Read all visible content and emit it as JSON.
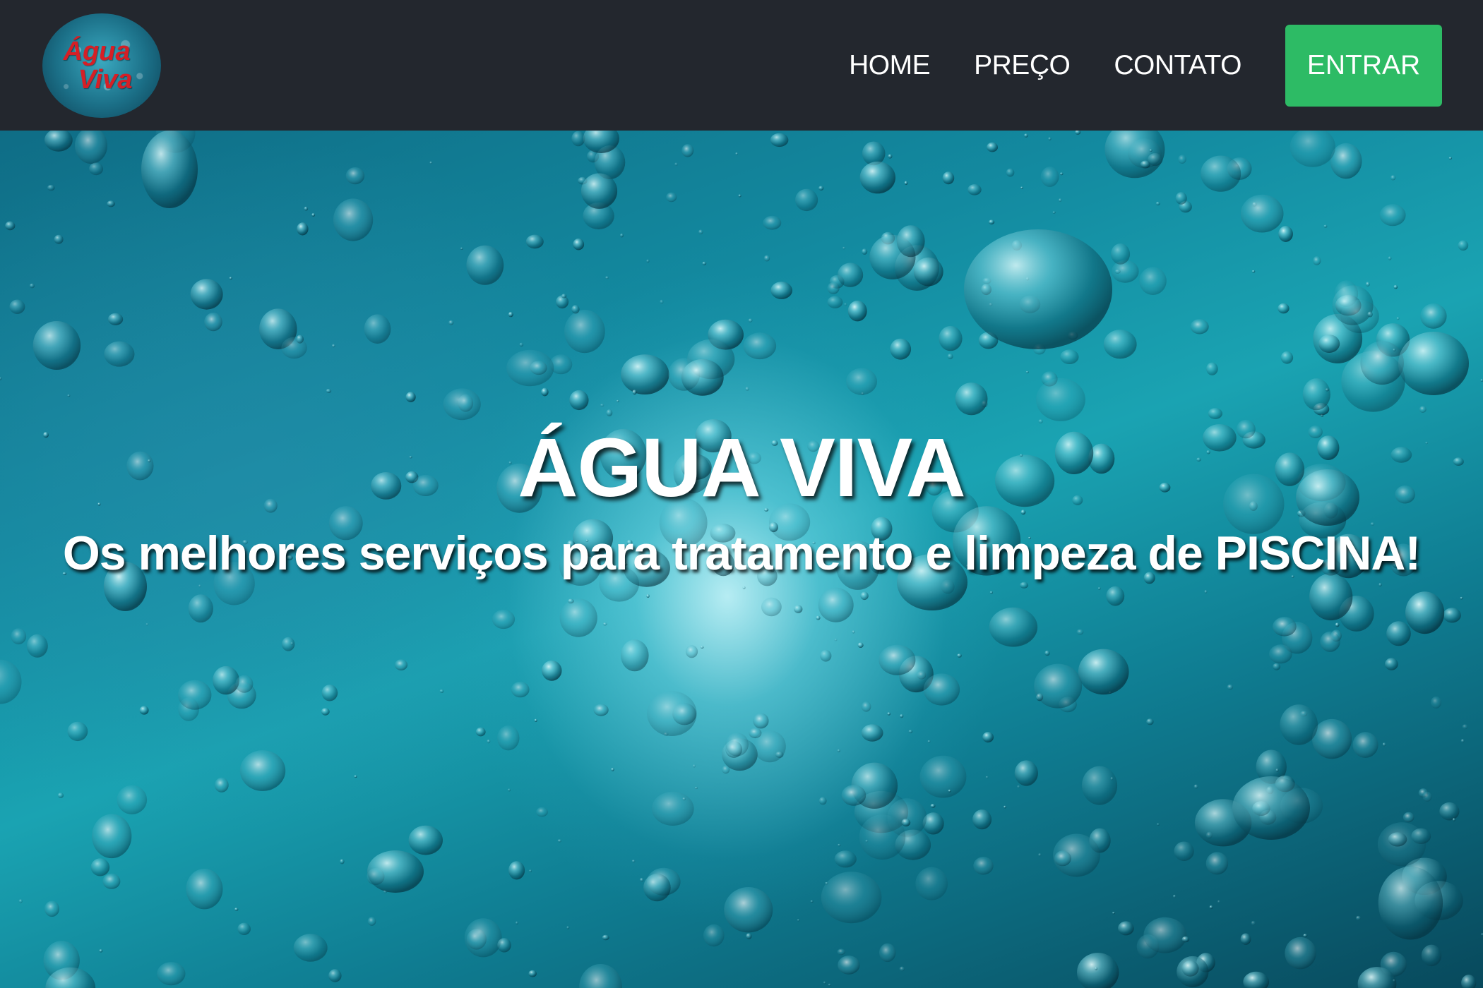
{
  "logo": {
    "line1": "Água",
    "line2": "Viva"
  },
  "nav": {
    "items": [
      {
        "label": "HOME"
      },
      {
        "label": "PREÇO"
      },
      {
        "label": "CONTATO"
      }
    ],
    "login_label": "ENTRAR"
  },
  "hero": {
    "title": "ÁGUA VIVA",
    "subtitle": "Os melhores serviços para tratamento e limpeza de PISCINA!"
  },
  "colors": {
    "navbar_bg": "#23272e",
    "login_button": "#2dbb65",
    "logo_text": "#d61f26",
    "water": "#138aa0"
  }
}
